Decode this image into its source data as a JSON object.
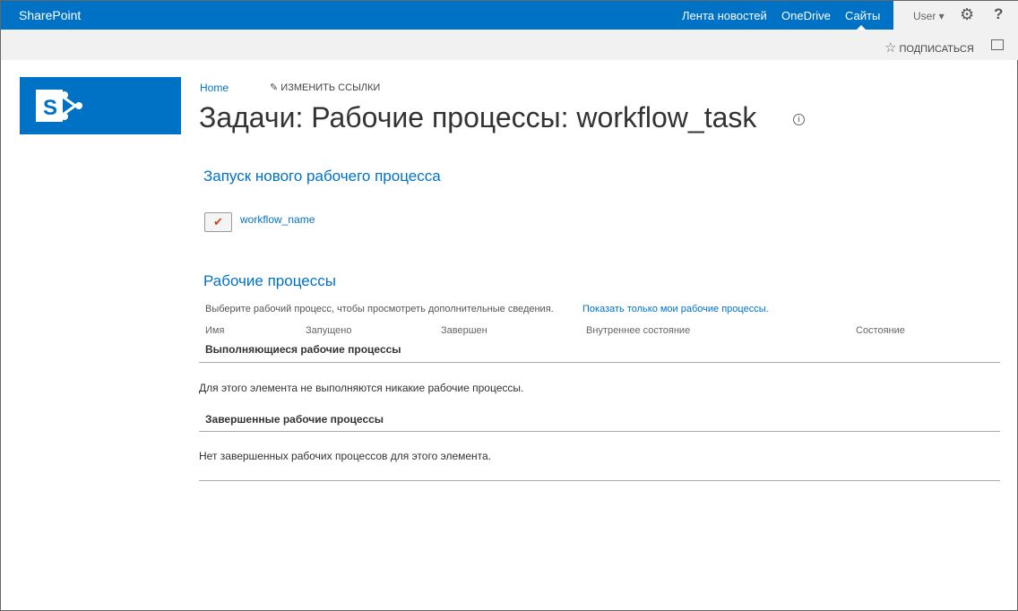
{
  "suite_bar": {
    "brand": "SharePoint",
    "links": [
      "Лента новостей",
      "OneDrive",
      "Сайты"
    ],
    "user": "User ▾"
  },
  "toolbar": {
    "follow": "ПОДПИСАТЬСЯ"
  },
  "breadcrumb": {
    "home": "Home",
    "edit_links": "ИЗМЕНИТЬ ССЫЛКИ"
  },
  "page": {
    "title": "Задачи: Рабочие процессы: workflow_task"
  },
  "start": {
    "heading": "Запуск нового рабочего процесса",
    "workflow": "workflow_name"
  },
  "workflows": {
    "heading": "Рабочие процессы",
    "hint": "Выберите рабочий процесс, чтобы просмотреть дополнительные сведения.",
    "show_mine": "Показать только мои рабочие процессы.",
    "columns": [
      "Имя",
      "Запущено",
      "Завершен",
      "Внутреннее состояние",
      "Состояние"
    ],
    "running_heading": "Выполняющиеся рабочие процессы",
    "running_empty": "Для этого элемента не выполняются никакие рабочие процессы.",
    "completed_heading": "Завершенные рабочие процессы",
    "completed_empty": "Нет завершенных рабочих процессов для этого элемента."
  }
}
